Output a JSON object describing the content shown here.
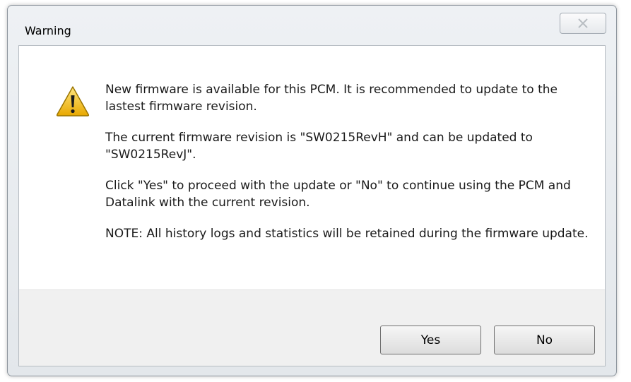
{
  "window": {
    "title": "Warning"
  },
  "message": {
    "paragraphs": [
      "New firmware is available for this PCM. It is recommended to update to the lastest firmware revision.",
      "The current firmware revision is \"SW0215RevH\" and can be  updated to \"SW0215RevJ\".",
      "Click \"Yes\" to proceed with the update or \"No\" to continue using the PCM and Datalink with the current revision.",
      "NOTE: All history logs and statistics will be retained during the firmware update."
    ]
  },
  "buttons": {
    "yes_label": "Yes",
    "no_label": "No"
  },
  "icons": {
    "warning": "warning-triangle-icon",
    "close": "close-icon"
  },
  "colors": {
    "warning_fill": "#f5c518",
    "client_bg": "#ffffff",
    "footer_bg": "#f0f0f0"
  }
}
